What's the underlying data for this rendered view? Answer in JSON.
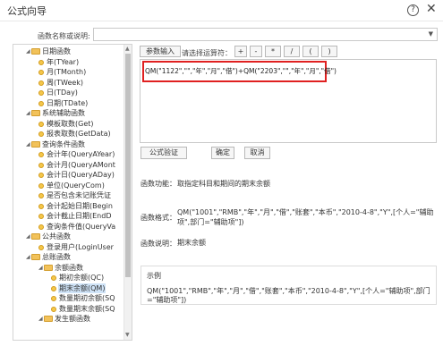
{
  "window": {
    "title": "公式向导",
    "help_glyph": "?",
    "close_glyph": "✕"
  },
  "name_field": {
    "label": "函数名称或说明:",
    "value": ""
  },
  "tree": [
    {
      "label": "日期函数",
      "kind": "folder",
      "expanded": true
    },
    {
      "label": "年(TYear)",
      "kind": "leaf"
    },
    {
      "label": "月(TMonth)",
      "kind": "leaf"
    },
    {
      "label": "周(TWeek)",
      "kind": "leaf"
    },
    {
      "label": "日(TDay)",
      "kind": "leaf"
    },
    {
      "label": "日期(TDate)",
      "kind": "leaf"
    },
    {
      "label": "系统辅助函数",
      "kind": "folder",
      "expanded": true
    },
    {
      "label": "模板取数(Get)",
      "kind": "leaf"
    },
    {
      "label": "报表取数(GetData)",
      "kind": "leaf"
    },
    {
      "label": "查询条件函数",
      "kind": "folder",
      "expanded": true
    },
    {
      "label": "会计年(QueryAYear)",
      "kind": "leaf"
    },
    {
      "label": "会计月(QueryAMont",
      "kind": "leaf"
    },
    {
      "label": "会计日(QueryADay)",
      "kind": "leaf"
    },
    {
      "label": "单位(QueryCom)",
      "kind": "leaf"
    },
    {
      "label": "是否包含未记账凭证",
      "kind": "leaf"
    },
    {
      "label": "会计起始日期(Begin",
      "kind": "leaf"
    },
    {
      "label": "会计截止日期(EndD",
      "kind": "leaf"
    },
    {
      "label": "查询条件值(QueryVa",
      "kind": "leaf"
    },
    {
      "label": "公共函数",
      "kind": "folder",
      "expanded": true
    },
    {
      "label": "登录用户(LoginUser",
      "kind": "leaf"
    },
    {
      "label": "总账函数",
      "kind": "folder",
      "expanded": true
    },
    {
      "label": "余额函数",
      "kind": "folder",
      "expanded": true
    },
    {
      "label": "期初余额(QC)",
      "kind": "leaf"
    },
    {
      "label": "期末余额(QM)",
      "kind": "leaf",
      "selected": true
    },
    {
      "label": "数量期初余额(SQ",
      "kind": "leaf"
    },
    {
      "label": "数量期末余额(SQ",
      "kind": "leaf"
    },
    {
      "label": "发生额函数",
      "kind": "folder",
      "expanded": true
    }
  ],
  "toolbar": {
    "param_button": "参数输入",
    "operator_label": "请选择运算符：",
    "operators": [
      "+",
      "-",
      "*",
      "/",
      "(",
      ")"
    ]
  },
  "editor": {
    "formula": "QM(\"1122\",\"\",\"年\",\"月\",\"借\")+QM(\"2203\",\"\",\"年\",\"月\",\"借\")"
  },
  "actions": {
    "validate": "公式验证",
    "ok": "确定",
    "cancel": "取消"
  },
  "info": {
    "function_label": "函数功能：",
    "function_value": "取指定科目和期间的期末余额",
    "format_label": "函数格式：",
    "format_line1": "QM(\"1001\",\"RMB\",\"年\",\"月\",\"借\",\"账套\",\"本币\",\"2010-4-8\",\"Y\",[个人=\"辅助",
    "format_line2": "项\",部门=\"辅助项\"])",
    "desc_label": "函数说明：",
    "desc_value": "期末余额",
    "example_label": "示例",
    "example_line1": "QM(\"1001\",\"RMB\",\"年\",\"月\",\"借\",\"账套\",\"本币\",\"2010-4-8\",\"Y\",[个人=\"辅助项\",部门",
    "example_line2": "=\"辅助项\"])"
  },
  "colors": {
    "highlight_border": "#e02020",
    "selected_bg": "#cfe3f7",
    "folder": "#f2c25a"
  }
}
